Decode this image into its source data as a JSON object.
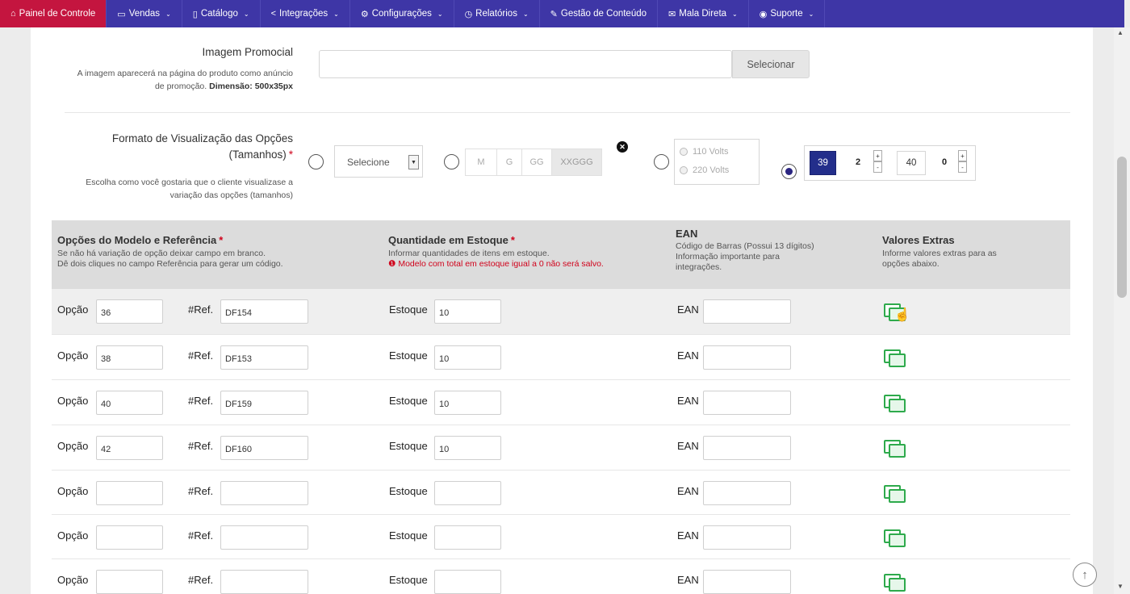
{
  "nav": {
    "items": [
      {
        "label": "Painel de Controle",
        "icon": "home-icon",
        "glyph": "⌂",
        "caret": false
      },
      {
        "label": "Vendas",
        "icon": "folder-icon",
        "glyph": "▭",
        "caret": true
      },
      {
        "label": "Catálogo",
        "icon": "book-icon",
        "glyph": "▯",
        "caret": true
      },
      {
        "label": "Integrações",
        "icon": "share-icon",
        "glyph": "<",
        "caret": true
      },
      {
        "label": "Configurações",
        "icon": "gear-icon",
        "glyph": "⚙",
        "caret": true
      },
      {
        "label": "Relatórios",
        "icon": "history-icon",
        "glyph": "◷",
        "caret": true
      },
      {
        "label": "Gestão de Conteúdo",
        "icon": "edit-icon",
        "glyph": "✎",
        "caret": false
      },
      {
        "label": "Mala Direta",
        "icon": "envelope-icon",
        "glyph": "✉",
        "caret": true
      },
      {
        "label": "Suporte",
        "icon": "lifebuoy-icon",
        "glyph": "◉",
        "caret": true
      }
    ],
    "active_color": "#c4153f",
    "bar_color": "#3e36a6"
  },
  "promo": {
    "title": "Imagem Promocial",
    "desc": "A imagem aparecerá na página do produto como anúncio de promoção.",
    "desc_bold": "Dimensão: 500x35px",
    "button": "Selecionar"
  },
  "format": {
    "title_line1": "Formato de Visualização das Opções",
    "title_line2": "(Tamanhos)",
    "required": "*",
    "desc": "Escolha como você gostaria que o cliente visualizase a variação das opções (tamanhos)",
    "select_label": "Selecione",
    "sizes": [
      "M",
      "G",
      "GG",
      "XXGGG"
    ],
    "volts": [
      "110 Volts",
      "220 Volts"
    ],
    "stepper": {
      "selected": "39",
      "qty1": "2",
      "other": "40",
      "qty2": "0",
      "plus": "+",
      "minus": "-"
    },
    "selected_option": 4
  },
  "table": {
    "headers": {
      "models": {
        "title": "Opções do Modelo e Referência",
        "req": "*",
        "desc1": "Se não há variação de opção deixar campo em branco.",
        "desc2": "Dê dois cliques no campo Referência para gerar um código."
      },
      "stock": {
        "title": "Quantidade em Estoque",
        "req": "*",
        "desc1": "Informar quantidades de itens em estoque.",
        "warn": "Modelo com total em estoque igual a 0 não será salvo."
      },
      "ean": {
        "title": "EAN",
        "desc1": "Código de Barras (Possui 13 dígitos)",
        "desc2": "Informação importante para",
        "desc3": "integrações."
      },
      "extras": {
        "title": "Valores Extras",
        "desc1": "Informe valores extras para as",
        "desc2": "opções abaixo."
      }
    },
    "labels": {
      "option": "Opção",
      "ref": "#Ref.",
      "stock": "Estoque",
      "ean": "EAN"
    },
    "rows": [
      {
        "option": "36",
        "ref": "DF154",
        "stock": "10",
        "ean": ""
      },
      {
        "option": "38",
        "ref": "DF153",
        "stock": "10",
        "ean": ""
      },
      {
        "option": "40",
        "ref": "DF159",
        "stock": "10",
        "ean": ""
      },
      {
        "option": "42",
        "ref": "DF160",
        "stock": "10",
        "ean": ""
      },
      {
        "option": "",
        "ref": "",
        "stock": "",
        "ean": ""
      },
      {
        "option": "",
        "ref": "",
        "stock": "",
        "ean": ""
      },
      {
        "option": "",
        "ref": "",
        "stock": "",
        "ean": ""
      }
    ]
  }
}
